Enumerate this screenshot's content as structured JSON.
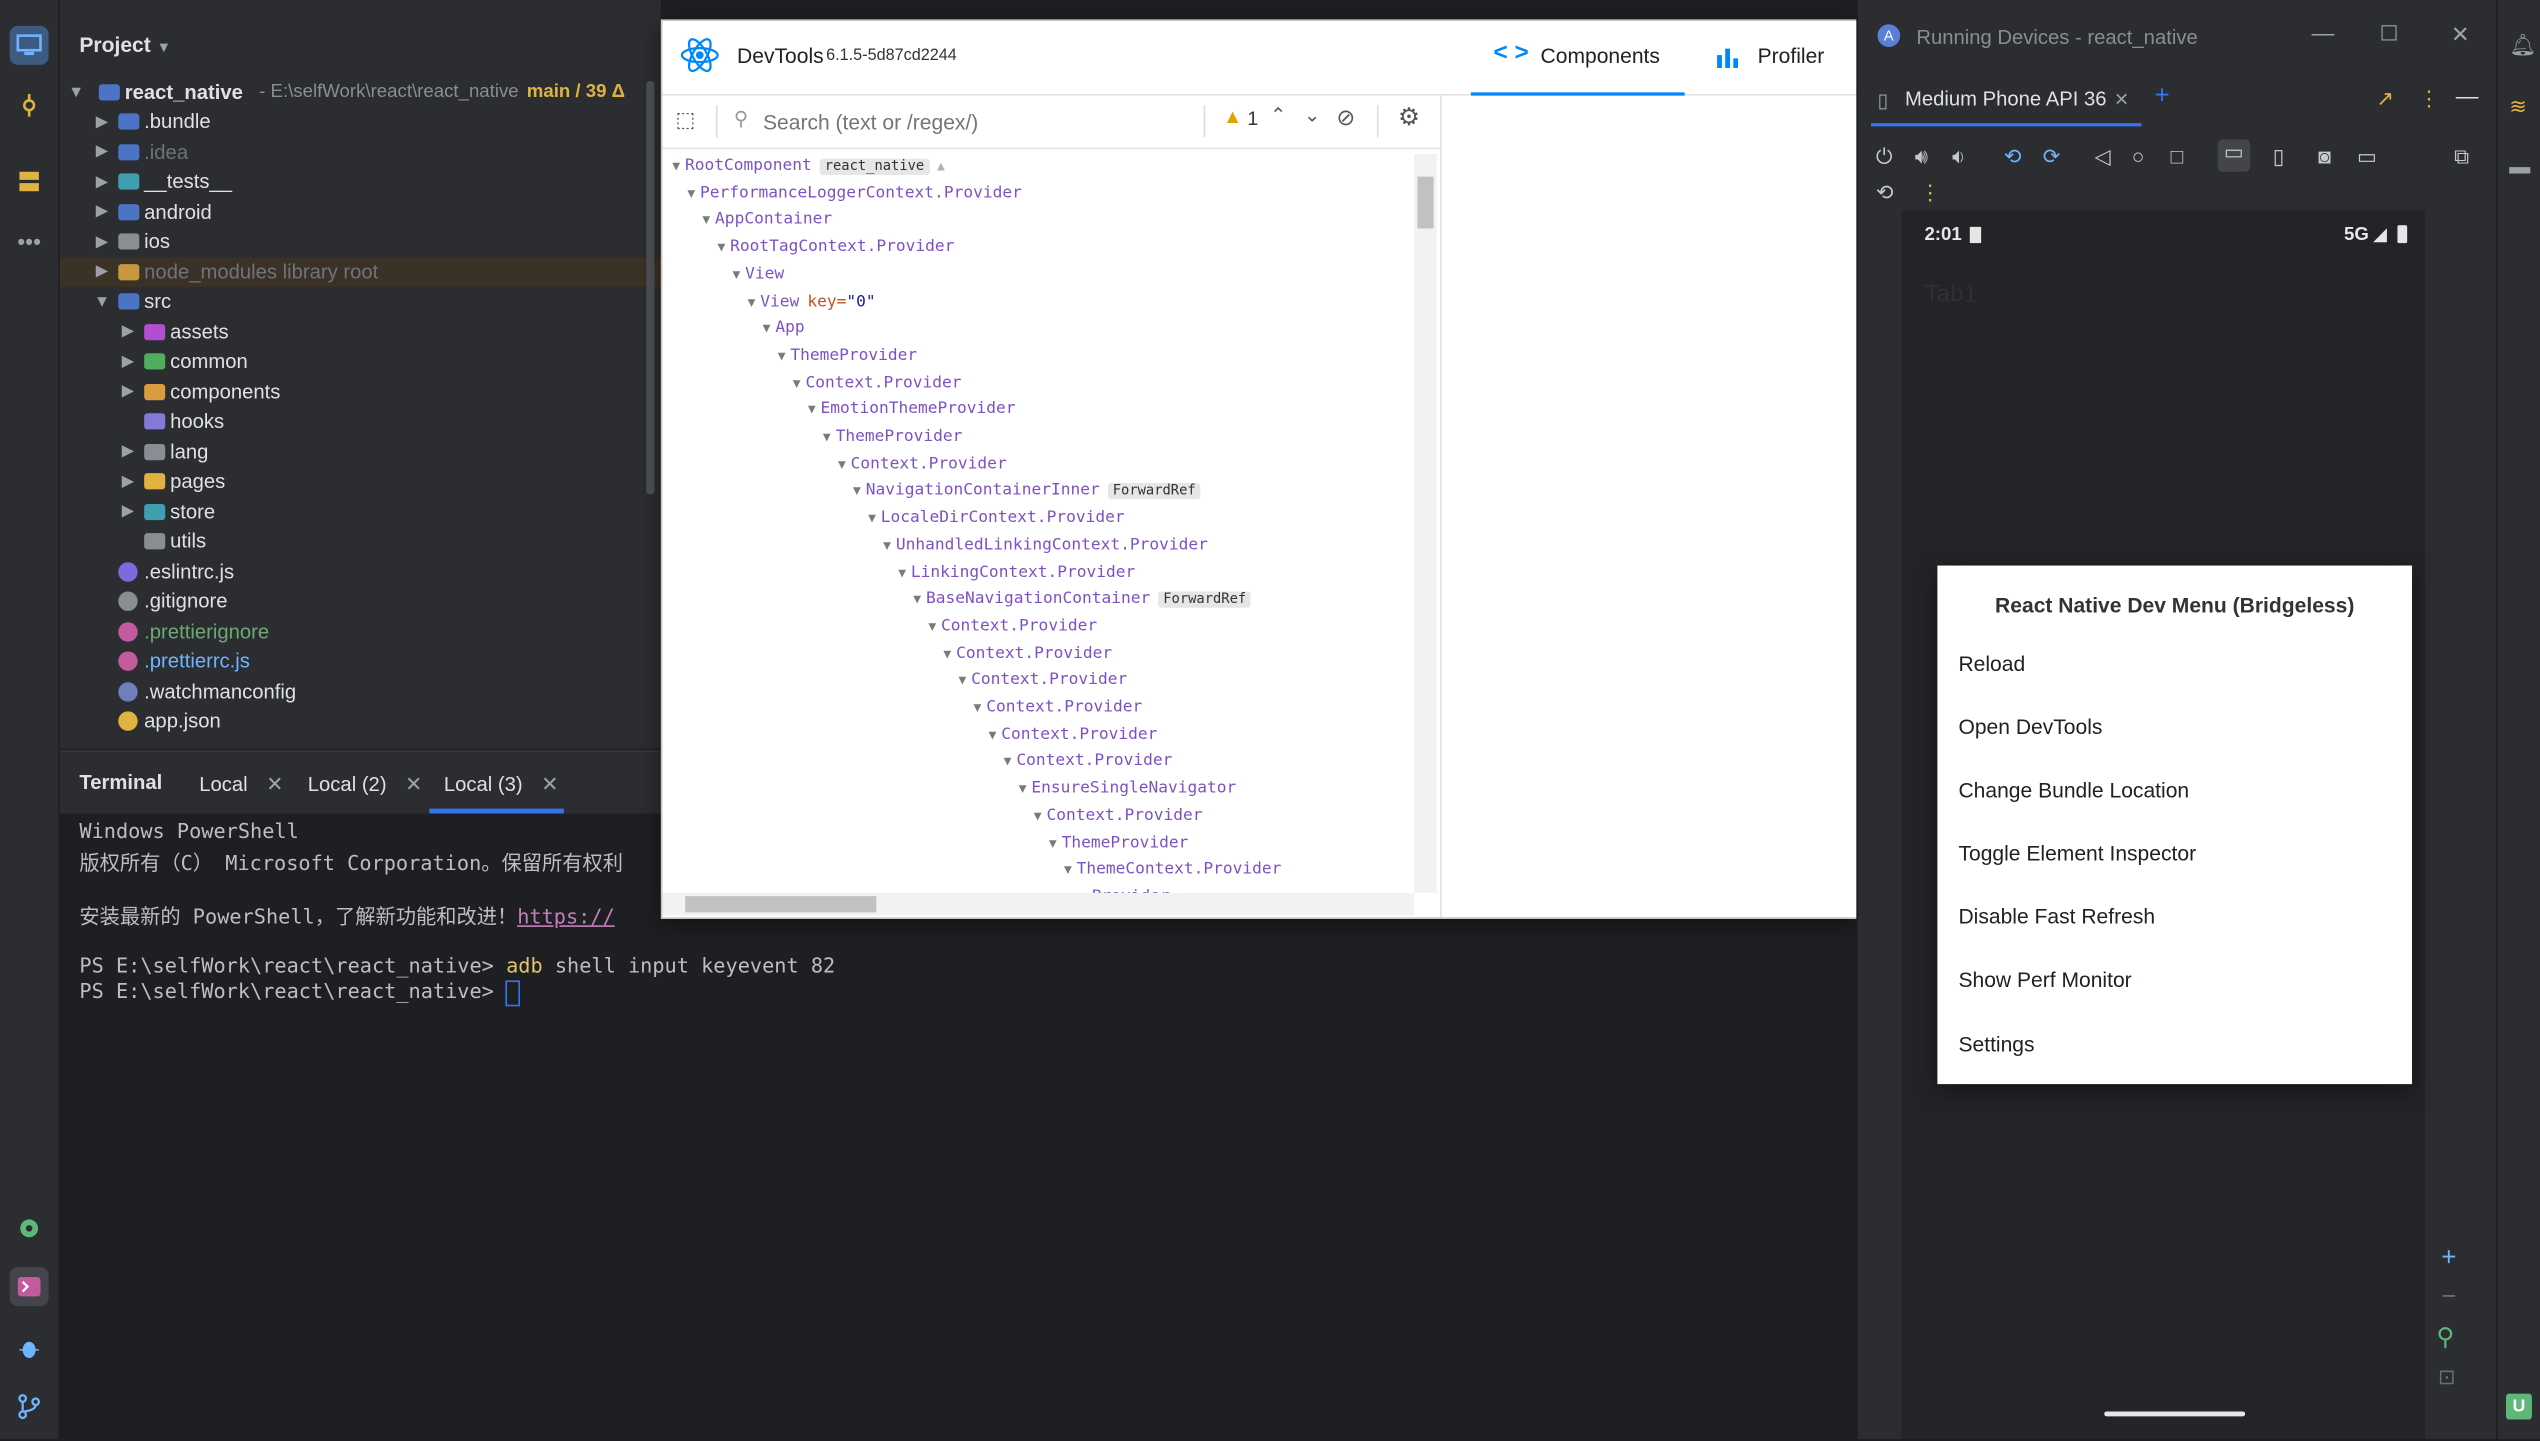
{
  "project": {
    "title": "Project",
    "root_name": "react_native",
    "root_path": "- E:\\selfWork\\react\\react_native",
    "root_branch": "main / 39 Δ",
    "items": [
      {
        "label": ".bundle",
        "kind": "folder",
        "color": "#4b74c4"
      },
      {
        "label": ".idea",
        "kind": "folder",
        "color": "#4b74c4",
        "dim": true
      },
      {
        "label": "__tests__",
        "kind": "folder",
        "color": "#3e9fb0"
      },
      {
        "label": "android",
        "kind": "folder",
        "color": "#4b74c4"
      },
      {
        "label": "ios",
        "kind": "folder",
        "color": "#8a8d93"
      },
      {
        "label": "node_modules  library root",
        "kind": "folder",
        "color": "#c8963e",
        "dim": true
      },
      {
        "label": "src",
        "kind": "folder",
        "color": "#4b74c4"
      },
      {
        "label": "assets",
        "kind": "folder",
        "color": "#b24fd0"
      },
      {
        "label": "common",
        "kind": "folder",
        "color": "#4fae5d"
      },
      {
        "label": "components",
        "kind": "folder",
        "color": "#d89b3e"
      },
      {
        "label": "hooks",
        "kind": "folder",
        "color": "#8479d6"
      },
      {
        "label": "lang",
        "kind": "folder",
        "color": "#8a8d93"
      },
      {
        "label": "pages",
        "kind": "folder",
        "color": "#e0b341"
      },
      {
        "label": "store",
        "kind": "folder",
        "color": "#3e9fb0"
      },
      {
        "label": "utils",
        "kind": "folder",
        "color": "#8a8d93"
      },
      {
        "label": ".eslintrc.js",
        "kind": "file",
        "color": "#7b6bdc"
      },
      {
        "label": ".gitignore",
        "kind": "file",
        "color": "#8a8d93"
      },
      {
        "label": ".prettierignore",
        "kind": "file",
        "color": "#c45a9e"
      },
      {
        "label": ".prettierrc.js",
        "kind": "file",
        "color": "#c45a9e"
      },
      {
        "label": ".watchmanconfig",
        "kind": "file",
        "color": "#6f7fb8"
      },
      {
        "label": "app.json",
        "kind": "file",
        "color": "#e0b341"
      }
    ]
  },
  "terminal": {
    "title": "Terminal",
    "tabs": [
      "Local",
      "Local (2)",
      "Local (3)"
    ],
    "lines": [
      "Windows PowerShell",
      "版权所有（C） Microsoft Corporation。保留所有权利",
      "",
      "安装最新的 PowerShell，了解新功能和改进！https://",
      "",
      "PS E:\\selfWork\\react\\react_native> adb shell input keyevent 82",
      "PS E:\\selfWork\\react\\react_native> "
    ],
    "line3_prefix": "安装最新的 PowerShell，了解新功能和改进！",
    "line3_link": "https://",
    "prompt": "PS E:\\selfWork\\react\\react_native>",
    "cmd_head": "adb",
    "cmd_rest": " shell input keyevent 82"
  },
  "devtools": {
    "title": "DevTools",
    "version": "6.1.5-5d87cd2244",
    "tab_components": "Components",
    "tab_profiler": "Profiler",
    "search_placeholder": "Search (text or /regex/)",
    "warning_count": "1",
    "tree": [
      {
        "name": "RootComponent",
        "badge": "react_native",
        "warn": true
      },
      {
        "name": "PerformanceLoggerContext.Provider"
      },
      {
        "name": "AppContainer"
      },
      {
        "name": "RootTagContext.Provider"
      },
      {
        "name": "View"
      },
      {
        "name": "View",
        "key": "\"0\""
      },
      {
        "name": "App"
      },
      {
        "name": "ThemeProvider"
      },
      {
        "name": "Context.Provider"
      },
      {
        "name": "EmotionThemeProvider"
      },
      {
        "name": "ThemeProvider"
      },
      {
        "name": "Context.Provider"
      },
      {
        "name": "NavigationContainerInner",
        "badge": "ForwardRef"
      },
      {
        "name": "LocaleDirContext.Provider"
      },
      {
        "name": "UnhandledLinkingContext.Provider"
      },
      {
        "name": "LinkingContext.Provider"
      },
      {
        "name": "BaseNavigationContainer",
        "badge": "ForwardRef"
      },
      {
        "name": "Context.Provider"
      },
      {
        "name": "Context.Provider"
      },
      {
        "name": "Context.Provider"
      },
      {
        "name": "Context.Provider"
      },
      {
        "name": "Context.Provider"
      },
      {
        "name": "Context.Provider"
      },
      {
        "name": "EnsureSingleNavigator"
      },
      {
        "name": "Context.Provider"
      },
      {
        "name": "ThemeProvider"
      },
      {
        "name": "ThemeContext.Provider"
      },
      {
        "name": "Provider"
      }
    ]
  },
  "running_devices": {
    "title": "Running Devices - react_native",
    "device_tab": "Medium Phone API 36",
    "status_time": "2:01",
    "status_network": "5G",
    "screen_label": "Tab1"
  },
  "dev_menu": {
    "title": "React Native Dev Menu (Bridgeless)",
    "items": [
      "Reload",
      "Open DevTools",
      "Change Bundle Location",
      "Toggle Element Inspector",
      "Disable Fast Refresh",
      "Show Perf Monitor",
      "Settings"
    ]
  },
  "colors": {
    "ide_bg": "#1e1f22",
    "panel_bg": "#2b2d30",
    "accent": "#3574f0",
    "react_purple": "#7d51c6",
    "devtools_blue": "#0088fa"
  }
}
